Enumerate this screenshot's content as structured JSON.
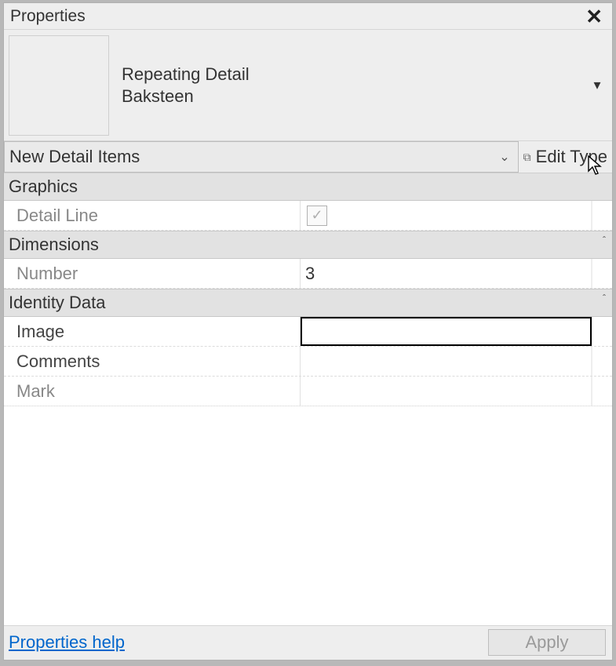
{
  "panel": {
    "title": "Properties",
    "close_glyph": "✕"
  },
  "type_selector": {
    "family": "Repeating Detail",
    "type": "Baksteen",
    "dropdown_glyph": "▾"
  },
  "filter": {
    "label": "New Detail Items",
    "chevron_glyph": "⌄"
  },
  "edit_type": {
    "icon_glyph": "⧉",
    "label": "Edit Type"
  },
  "groups": [
    {
      "name": "Graphics",
      "collapsible": false,
      "rows": [
        {
          "label": "Detail Line",
          "kind": "checkbox",
          "value": true,
          "editable": false
        }
      ]
    },
    {
      "name": "Dimensions",
      "collapsible": true,
      "rows": [
        {
          "label": "Number",
          "kind": "text",
          "value": "3",
          "editable": false
        }
      ]
    },
    {
      "name": "Identity Data",
      "collapsible": true,
      "rows": [
        {
          "label": "Image",
          "kind": "text",
          "value": "",
          "editable": true,
          "selected": true
        },
        {
          "label": "Comments",
          "kind": "text",
          "value": "",
          "editable": true
        },
        {
          "label": "Mark",
          "kind": "text",
          "value": "",
          "editable": false
        }
      ]
    }
  ],
  "footer": {
    "help_label": "Properties help",
    "apply_label": "Apply"
  },
  "glyphs": {
    "check": "✓",
    "collapse": "ˆ"
  }
}
